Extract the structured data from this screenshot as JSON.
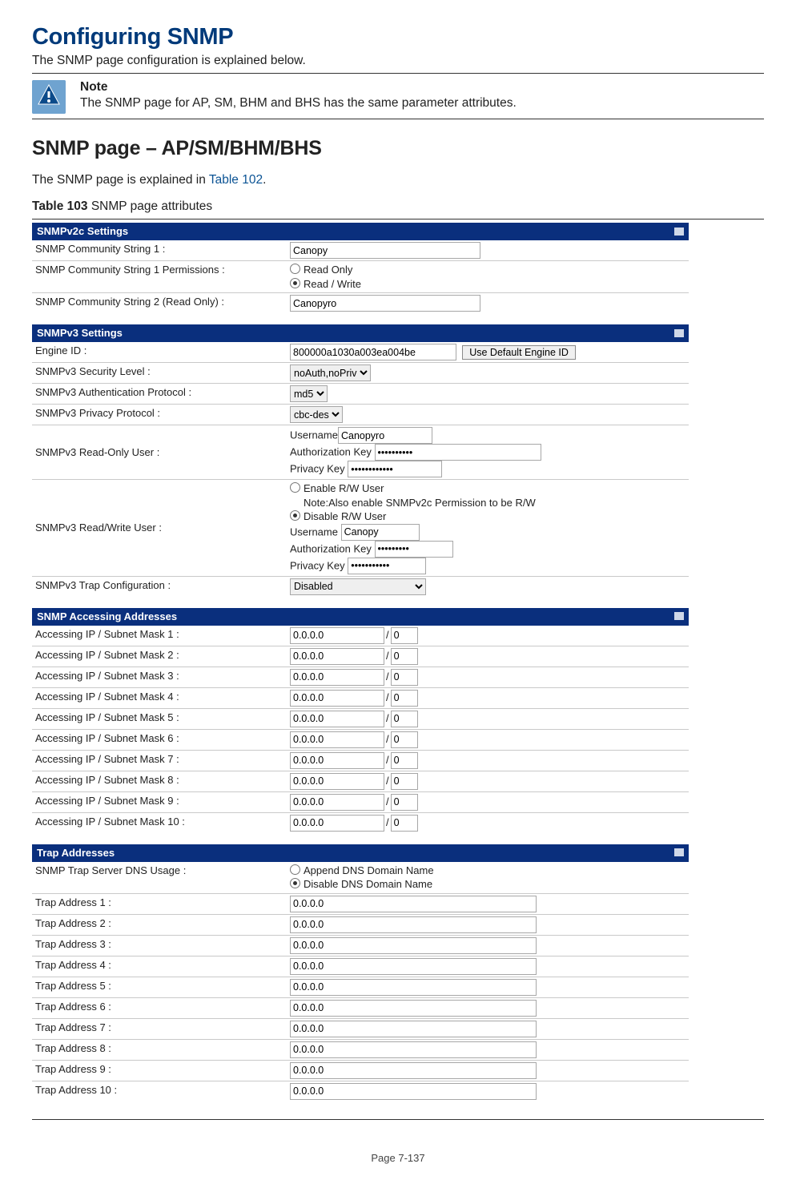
{
  "title": "Configuring SNMP",
  "intro": "The SNMP page configuration is explained below.",
  "note": {
    "title": "Note",
    "body": "The SNMP page for AP, SM, BHM and BHS has the same parameter attributes."
  },
  "subtitle": "SNMP page – AP/SM/BHM/BHS",
  "explain_prefix": "The SNMP page is explained in ",
  "explain_link": "Table 102",
  "explain_suffix": ".",
  "table_caption_strong": "Table 103",
  "table_caption_rest": " SNMP page attributes",
  "snmp2c": {
    "heading": "SNMPv2c Settings",
    "rows": {
      "cs1_label": "SNMP Community String 1 :",
      "cs1_value": "Canopy",
      "perm_label": "SNMP Community String 1 Permissions :",
      "perm_ro": "Read Only",
      "perm_rw": "Read / Write",
      "cs2_label": "SNMP Community String 2 (Read Only) :",
      "cs2_value": "Canopyro"
    }
  },
  "snmp3": {
    "heading": "SNMPv3 Settings",
    "engine_label": "Engine ID :",
    "engine_value": "800000a1030a003ea004be",
    "engine_btn": "Use Default Engine ID",
    "sec_label": "SNMPv3 Security Level :",
    "sec_value": "noAuth,noPriv",
    "auth_label": "SNMPv3 Authentication Protocol :",
    "auth_value": "md5",
    "priv_label": "SNMPv3 Privacy Protocol :",
    "priv_value": "cbc-des",
    "ro_label": "SNMPv3 Read-Only User :",
    "ro_user_lbl": "Username",
    "ro_user_val": "Canopyro",
    "ro_auth_lbl": "Authorization Key",
    "ro_priv_lbl": "Privacy Key",
    "rw_label": "SNMPv3 Read/Write User :",
    "rw_enable": "Enable R/W User",
    "rw_note": "Note:Also enable SNMPv2c Permission to be R/W",
    "rw_disable": "Disable R/W User",
    "rw_user_lbl": "Username",
    "rw_user_val": "Canopy",
    "rw_auth_lbl": "Authorization Key",
    "rw_priv_lbl": "Privacy Key",
    "trap_label": "SNMPv3 Trap Configuration :",
    "trap_value": "Disabled"
  },
  "access": {
    "heading": "SNMP Accessing Addresses",
    "rows": [
      {
        "label": "Accessing IP / Subnet Mask 1 :",
        "ip": "0.0.0.0",
        "mask": "0"
      },
      {
        "label": "Accessing IP / Subnet Mask 2 :",
        "ip": "0.0.0.0",
        "mask": "0"
      },
      {
        "label": "Accessing IP / Subnet Mask 3 :",
        "ip": "0.0.0.0",
        "mask": "0"
      },
      {
        "label": "Accessing IP / Subnet Mask 4 :",
        "ip": "0.0.0.0",
        "mask": "0"
      },
      {
        "label": "Accessing IP / Subnet Mask 5 :",
        "ip": "0.0.0.0",
        "mask": "0"
      },
      {
        "label": "Accessing IP / Subnet Mask 6 :",
        "ip": "0.0.0.0",
        "mask": "0"
      },
      {
        "label": "Accessing IP / Subnet Mask 7 :",
        "ip": "0.0.0.0",
        "mask": "0"
      },
      {
        "label": "Accessing IP / Subnet Mask 8 :",
        "ip": "0.0.0.0",
        "mask": "0"
      },
      {
        "label": "Accessing IP / Subnet Mask 9 :",
        "ip": "0.0.0.0",
        "mask": "0"
      },
      {
        "label": "Accessing IP / Subnet Mask 10 :",
        "ip": "0.0.0.0",
        "mask": "0"
      }
    ]
  },
  "trap": {
    "heading": "Trap Addresses",
    "dns_label": "SNMP Trap Server DNS Usage :",
    "dns_append": "Append DNS Domain Name",
    "dns_disable": "Disable DNS Domain Name",
    "rows": [
      {
        "label": "Trap Address 1 :",
        "ip": "0.0.0.0"
      },
      {
        "label": "Trap Address 2 :",
        "ip": "0.0.0.0"
      },
      {
        "label": "Trap Address 3 :",
        "ip": "0.0.0.0"
      },
      {
        "label": "Trap Address 4 :",
        "ip": "0.0.0.0"
      },
      {
        "label": "Trap Address 5 :",
        "ip": "0.0.0.0"
      },
      {
        "label": "Trap Address 6 :",
        "ip": "0.0.0.0"
      },
      {
        "label": "Trap Address 7 :",
        "ip": "0.0.0.0"
      },
      {
        "label": "Trap Address 8 :",
        "ip": "0.0.0.0"
      },
      {
        "label": "Trap Address 9 :",
        "ip": "0.0.0.0"
      },
      {
        "label": "Trap Address 10 :",
        "ip": "0.0.0.0"
      }
    ]
  },
  "page_number": "Page 7-137"
}
